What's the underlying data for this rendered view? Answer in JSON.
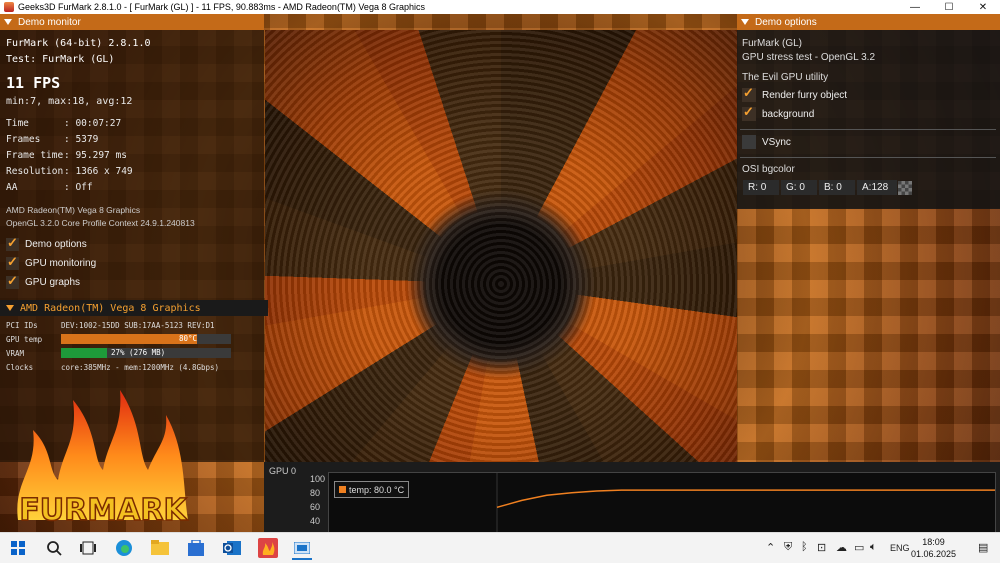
{
  "window": {
    "title": "Geeks3D FurMark 2.8.1.0 - [ FurMark (GL) ] - 11 FPS, 90.883ms - AMD Radeon(TM) Vega 8 Graphics",
    "minimize": "—",
    "maximize": "☐",
    "close": "✕"
  },
  "demo_monitor": {
    "header": "Demo monitor",
    "app_version": "FurMark (64-bit) 2.8.1.0",
    "test": "Test: FurMark (GL)",
    "fps": "11 FPS",
    "fps_stats": "min:7, max:18, avg:12",
    "stats": [
      {
        "key": "Time",
        "value": ": 00:07:27"
      },
      {
        "key": "Frames",
        "value": ": 5379"
      },
      {
        "key": "Frame time",
        "value": ": 95.297 ms"
      },
      {
        "key": "Resolution",
        "value": ": 1366 x 749"
      },
      {
        "key": "AA",
        "value": ": Off"
      }
    ],
    "gpu_name": "AMD Radeon(TM) Vega 8 Graphics",
    "gl_info": "OpenGL 3.2.0 Core Profile Context 24.9.1.240813",
    "checkboxes": [
      {
        "label": "Demo options",
        "checked": true
      },
      {
        "label": "GPU monitoring",
        "checked": true
      },
      {
        "label": "GPU graphs",
        "checked": true
      }
    ]
  },
  "gpu_monitor": {
    "header": "AMD Radeon(TM) Vega 8 Graphics",
    "pci_label": "PCI IDs",
    "pci_value": "DEV:1002-15DD SUB:17AA-5123 REV:D1",
    "temp_label": "GPU temp",
    "temp_value": "80°C",
    "temp_fraction": 0.8,
    "vram_label": "VRAM",
    "vram_value": "27% (276 MB)",
    "vram_fraction": 0.27,
    "clocks_label": "Clocks",
    "clocks_value": "core:385MHz - mem:1200MHz (4.8Gbps)",
    "temp_color": "#d9731a",
    "vram_color": "#1e9a3a"
  },
  "logo": {
    "text": "FURMARK"
  },
  "demo_options": {
    "header": "Demo options",
    "renderer": "FurMark (GL)",
    "description": "GPU stress test - OpenGL 3.2",
    "utility": "The Evil GPU utility",
    "checkboxes": [
      {
        "label": "Render furry object",
        "checked": true
      },
      {
        "label": "background",
        "checked": true
      }
    ],
    "vsync": {
      "label": "VSync",
      "checked": false
    },
    "osi_label": "OSI bgcolor",
    "color_fields": [
      "R: 0",
      "G: 0",
      "B: 0",
      "A:128"
    ]
  },
  "graph": {
    "label": "GPU 0",
    "legend": "temp: 80.0 °C",
    "y_ticks": [
      "100",
      "80",
      "60",
      "40"
    ]
  },
  "chart_data": {
    "type": "line",
    "series": [
      {
        "name": "temp: 80.0 °C",
        "values": [
          60,
          68,
          74,
          77,
          79,
          80,
          80,
          80,
          80,
          80,
          80,
          80,
          80,
          80,
          80,
          80,
          80,
          80,
          80,
          80,
          80
        ]
      }
    ],
    "ylim": [
      30,
      100
    ],
    "color": "#f08020"
  },
  "taskbar": {
    "time": "18:09",
    "date": "01.06.2025",
    "language": "ENG",
    "icons": [
      "windows-start-icon",
      "search-icon",
      "task-view-icon",
      "edge-icon",
      "file-explorer-icon",
      "store-icon",
      "outlook-icon",
      "furmark-icon",
      "app-window-icon"
    ]
  },
  "colors": {
    "accent": "#c46a18",
    "check": "#f5a030"
  }
}
